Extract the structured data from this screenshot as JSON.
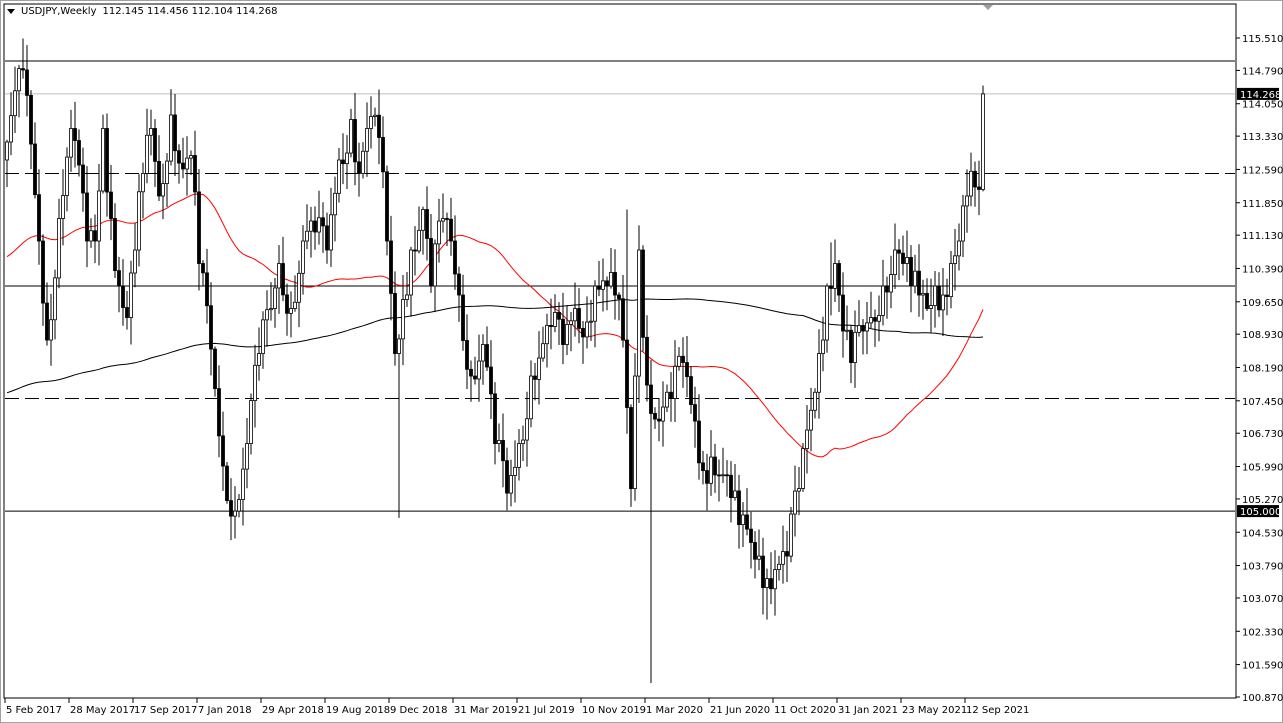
{
  "header": {
    "symbol_timeframe": "USDJPY,Weekly",
    "ohlc": "112.145 114.456 112.104 114.268"
  },
  "chart_data": {
    "type": "candlestick",
    "title": "USDJPY,Weekly",
    "ylim": [
      100.87,
      115.51
    ],
    "y_ticks": [
      "115.510",
      "114.790",
      "114.050",
      "113.330",
      "112.590",
      "111.850",
      "111.130",
      "110.390",
      "109.650",
      "108.930",
      "108.190",
      "107.450",
      "106.730",
      "105.990",
      "105.270",
      "104.530",
      "103.790",
      "103.070",
      "102.330",
      "101.590",
      "100.870"
    ],
    "x_ticks": [
      {
        "week": 0,
        "label": "5 Feb 2017"
      },
      {
        "week": 16,
        "label": "28 May 2017"
      },
      {
        "week": 32,
        "label": "17 Sep 2017"
      },
      {
        "week": 48,
        "label": "7 Jan 2018"
      },
      {
        "week": 64,
        "label": "29 Apr 2018"
      },
      {
        "week": 80,
        "label": "19 Aug 2018"
      },
      {
        "week": 96,
        "label": "9 Dec 2018"
      },
      {
        "week": 112,
        "label": "31 Mar 2019"
      },
      {
        "week": 128,
        "label": "21 Jul 2019"
      },
      {
        "week": 144,
        "label": "10 Nov 2019"
      },
      {
        "week": 160,
        "label": "1 Mar 2020"
      },
      {
        "week": 176,
        "label": "21 Jun 2020"
      },
      {
        "week": 192,
        "label": "11 Oct 2020"
      },
      {
        "week": 208,
        "label": "31 Jan 2021"
      },
      {
        "week": 224,
        "label": "23 May 2021"
      },
      {
        "week": 240,
        "label": "12 Sep 2021"
      }
    ],
    "weeks": 245,
    "close_path": [
      [
        0,
        113.2
      ],
      [
        4,
        114.8
      ],
      [
        8,
        111.0
      ],
      [
        10,
        108.8
      ],
      [
        13,
        111.5
      ],
      [
        16,
        113.5
      ],
      [
        20,
        111.0
      ],
      [
        22,
        111.0
      ],
      [
        24,
        113.5
      ],
      [
        26,
        111.5
      ],
      [
        28,
        110.0
      ],
      [
        30,
        109.3
      ],
      [
        32,
        110.8
      ],
      [
        34,
        112.5
      ],
      [
        36,
        113.5
      ],
      [
        38,
        112.0
      ],
      [
        41,
        113.8
      ],
      [
        44,
        112.6
      ],
      [
        46,
        112.9
      ],
      [
        48,
        110.5
      ],
      [
        51,
        108.6
      ],
      [
        54,
        106.0
      ],
      [
        57,
        105.0
      ],
      [
        60,
        106.5
      ],
      [
        63,
        108.5
      ],
      [
        66,
        109.5
      ],
      [
        68,
        110.5
      ],
      [
        71,
        109.5
      ],
      [
        74,
        111.0
      ],
      [
        77,
        111.2
      ],
      [
        80,
        110.8
      ],
      [
        83,
        112.8
      ],
      [
        86,
        113.7
      ],
      [
        88,
        112.5
      ],
      [
        90,
        113.5
      ],
      [
        93,
        113.3
      ],
      [
        95,
        111.0
      ],
      [
        97,
        108.5
      ],
      [
        99,
        109.7
      ],
      [
        101,
        110.8
      ],
      [
        104,
        111.7
      ],
      [
        106,
        110.0
      ],
      [
        109,
        111.5
      ],
      [
        111,
        111.0
      ],
      [
        113,
        109.8
      ],
      [
        116,
        108.0
      ],
      [
        119,
        108.7
      ],
      [
        122,
        106.5
      ],
      [
        125,
        105.4
      ],
      [
        128,
        106.5
      ],
      [
        131,
        108.0
      ],
      [
        133,
        108.4
      ],
      [
        136,
        109.1
      ],
      [
        139,
        108.7
      ],
      [
        142,
        109.5
      ],
      [
        145,
        109.2
      ],
      [
        147,
        110.0
      ],
      [
        150,
        110.0
      ],
      [
        152,
        109.8
      ],
      [
        154,
        108.8
      ],
      [
        156,
        105.5
      ],
      [
        157,
        108.0
      ],
      [
        158,
        110.8
      ],
      [
        160,
        107.8
      ],
      [
        163,
        107.0
      ],
      [
        166,
        107.5
      ],
      [
        169,
        108.3
      ],
      [
        172,
        107.0
      ],
      [
        174,
        105.9
      ],
      [
        176,
        106.2
      ],
      [
        178,
        105.8
      ],
      [
        181,
        105.3
      ],
      [
        183,
        104.7
      ],
      [
        185,
        104.6
      ],
      [
        188,
        104.0
      ],
      [
        190,
        103.5
      ],
      [
        192,
        103.7
      ],
      [
        195,
        104.0
      ],
      [
        198,
        105.5
      ],
      [
        200,
        106.8
      ],
      [
        203,
        108.5
      ],
      [
        205,
        110.0
      ],
      [
        207,
        110.5
      ],
      [
        209,
        109.0
      ],
      [
        211,
        108.3
      ],
      [
        214,
        109.0
      ],
      [
        216,
        109.3
      ],
      [
        219,
        110.0
      ],
      [
        222,
        110.8
      ],
      [
        224,
        110.5
      ],
      [
        226,
        110.0
      ],
      [
        228,
        109.8
      ],
      [
        230,
        109.5
      ],
      [
        232,
        110.0
      ],
      [
        234,
        109.8
      ],
      [
        236,
        110.5
      ],
      [
        238,
        111.0
      ],
      [
        240,
        112.0
      ],
      [
        242,
        112.2
      ],
      [
        243,
        112.145
      ],
      [
        244,
        114.268
      ]
    ],
    "wick_extremes": [
      {
        "week": 4,
        "high": 115.5
      },
      {
        "week": 98,
        "low": 104.85
      },
      {
        "week": 155,
        "high": 111.7
      },
      {
        "week": 161,
        "low": 101.18
      },
      {
        "week": 206,
        "high": 110.97
      },
      {
        "week": 190,
        "low": 102.59
      }
    ],
    "last_candle": {
      "open": 112.145,
      "high": 114.456,
      "low": 112.104,
      "close": 114.268
    },
    "moving_averages": [
      {
        "period": 50,
        "color": "#ff0000",
        "pre_level": 110.6
      },
      {
        "period": 200,
        "color": "#000000",
        "pre_level": 107.6
      }
    ],
    "levels": [
      {
        "price": 115.0,
        "style": "solid"
      },
      {
        "price": 112.5,
        "style": "dashed"
      },
      {
        "price": 110.0,
        "style": "solid"
      },
      {
        "price": 107.5,
        "style": "dashed"
      },
      {
        "price": 105.0,
        "style": "solid"
      }
    ],
    "price_tags": [
      {
        "label": "114.268",
        "price": 114.268
      },
      {
        "label": "105.000",
        "price": 105.0
      }
    ],
    "colors": {
      "bull_body": "#ffffff",
      "bear_body": "#000000",
      "outline": "#000000",
      "bid_line": "#c0c0c0"
    }
  }
}
